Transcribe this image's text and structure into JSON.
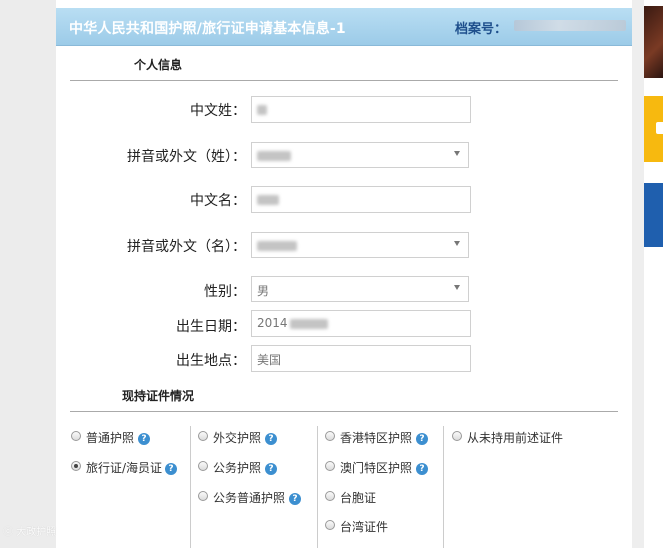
{
  "header": {
    "title": "中华人民共和国护照/旅行证申请基本信息-1",
    "file_label": "档案号："
  },
  "personal_info": {
    "section_title": "个人信息",
    "fields": {
      "cn_surname": {
        "label": "中文姓："
      },
      "pinyin_surname": {
        "label": "拼音或外文（姓）："
      },
      "cn_given_name": {
        "label": "中文名："
      },
      "pinyin_given_name": {
        "label": "拼音或外文（名）："
      },
      "gender": {
        "label": "性别：",
        "value": "男"
      },
      "birth_date": {
        "label": "出生日期：",
        "value": "2014"
      },
      "birth_place": {
        "label": "出生地点：",
        "value": "美国"
      }
    }
  },
  "documents": {
    "section_title": "现持证件情况",
    "options": {
      "ordinary_passport": "普通护照",
      "travel_cert": "旅行证/海员证",
      "diplomatic_passport": "外交护照",
      "service_passport": "公务护照",
      "official_ordinary_passport": "公务普通护照",
      "hk_sar_passport": "香港特区护照",
      "macau_sar_passport": "澳门特区护照",
      "mtp": "台胞证",
      "taiwan_cert": "台湾证件",
      "never_held": "从未持用前述证件"
    },
    "selected": "travel_cert",
    "help_glyph": "?"
  },
  "watermark": "ⓒ 大政护照"
}
